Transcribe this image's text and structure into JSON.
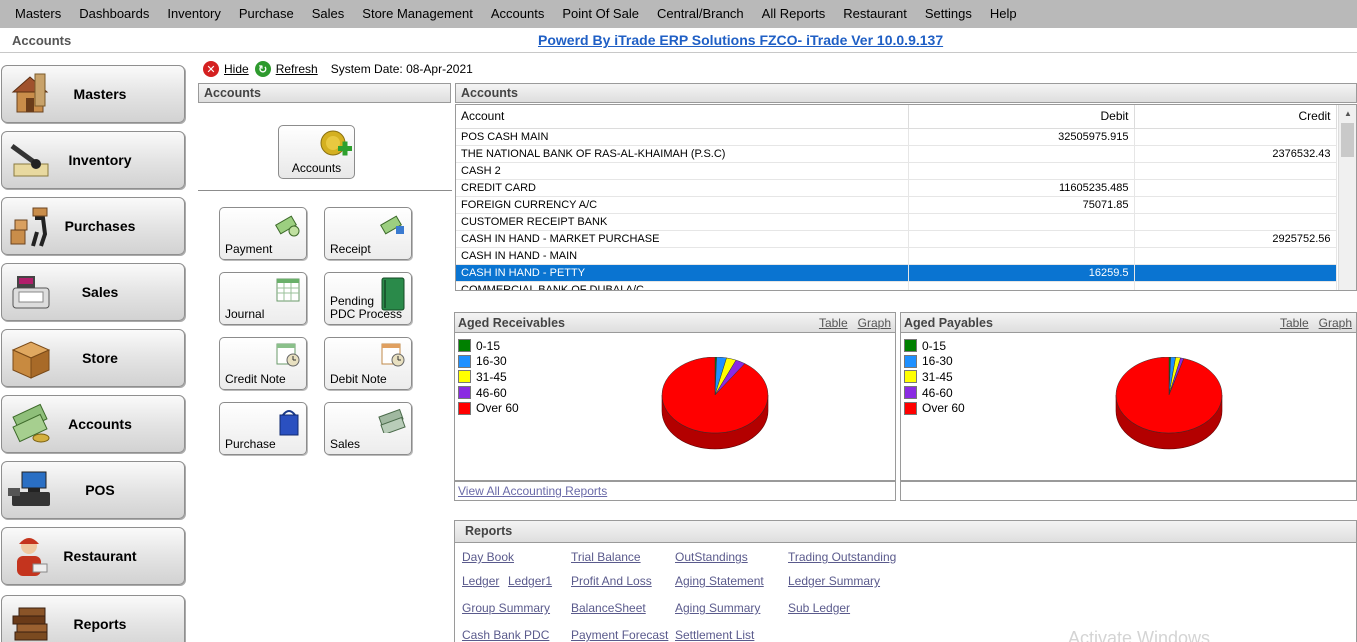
{
  "menu": [
    "Masters",
    "Dashboards",
    "Inventory",
    "Purchase",
    "Sales",
    "Store Management",
    "Accounts",
    "Point Of Sale",
    "Central/Branch",
    "All Reports",
    "Restaurant",
    "Settings",
    "Help"
  ],
  "header": {
    "breadcrumb": "Accounts",
    "brand": "Powerd By iTrade ERP Solutions FZCO- iTrade Ver 10.0.9.137"
  },
  "sidebar": [
    {
      "label": "Masters",
      "icon": "house-icon"
    },
    {
      "label": "Inventory",
      "icon": "stamp-icon"
    },
    {
      "label": "Purchases",
      "icon": "porter-icon"
    },
    {
      "label": "Sales",
      "icon": "cash-register-icon"
    },
    {
      "label": "Store",
      "icon": "boxes-icon"
    },
    {
      "label": "Accounts",
      "icon": "money-icon"
    },
    {
      "label": "POS",
      "icon": "pos-terminal-icon"
    },
    {
      "label": "Restaurant",
      "icon": "chef-icon"
    },
    {
      "label": "Reports",
      "icon": "books-icon"
    }
  ],
  "toolbar": {
    "hide": "Hide",
    "refresh": "Refresh",
    "system_date": "System Date: 08-Apr-2021"
  },
  "left_panel": {
    "title": "Accounts",
    "main_tile": "Accounts",
    "tiles": [
      {
        "label": "Payment",
        "icon": "payment-icon"
      },
      {
        "label": "Receipt",
        "icon": "receipt-icon"
      },
      {
        "label": "Journal",
        "icon": "journal-icon"
      },
      {
        "label": "Pending\nPDC Process",
        "label1": "Pending",
        "label2": "PDC Process",
        "icon": "ledger-book-icon"
      },
      {
        "label": "Credit Note",
        "icon": "credit-note-icon"
      },
      {
        "label": "Debit Note",
        "icon": "debit-note-icon"
      },
      {
        "label": "Purchase",
        "icon": "shopping-bag-icon"
      },
      {
        "label": "Sales",
        "icon": "sales-money-icon"
      }
    ]
  },
  "grid": {
    "title": "Accounts",
    "columns": [
      "Account",
      "Debit",
      "Credit"
    ],
    "rows": [
      {
        "account": "POS CASH MAIN",
        "debit": "32505975.915",
        "credit": ""
      },
      {
        "account": "THE NATIONAL BANK OF RAS-AL-KHAIMAH (P.S.C)",
        "debit": "",
        "credit": "2376532.43"
      },
      {
        "account": "CASH 2",
        "debit": "",
        "credit": ""
      },
      {
        "account": "CREDIT CARD",
        "debit": "11605235.485",
        "credit": ""
      },
      {
        "account": "FOREIGN CURRENCY A/C",
        "debit": "75071.85",
        "credit": ""
      },
      {
        "account": "CUSTOMER RECEIPT BANK",
        "debit": "",
        "credit": ""
      },
      {
        "account": "CASH IN HAND - MARKET PURCHASE",
        "debit": "",
        "credit": "2925752.56"
      },
      {
        "account": "CASH IN HAND - MAIN",
        "debit": "",
        "credit": ""
      },
      {
        "account": "CASH IN HAND - PETTY",
        "debit": "16259.5",
        "credit": "",
        "selected": true
      },
      {
        "account": "COMMERCIAL BANK OF DUBAI A/C",
        "debit": "",
        "credit": ""
      }
    ]
  },
  "aged_receivables": {
    "title": "Aged Receivables",
    "links": [
      "Table",
      "Graph"
    ],
    "legend": [
      "0-15",
      "16-30",
      "31-45",
      "46-60",
      "Over 60"
    ]
  },
  "aged_payables": {
    "title": "Aged Payables",
    "links": [
      "Table",
      "Graph"
    ],
    "legend": [
      "0-15",
      "16-30",
      "31-45",
      "46-60",
      "Over 60"
    ]
  },
  "colors": {
    "b0_15": "#008000",
    "b16_30": "#1e90ff",
    "b31_45": "#ffff00",
    "b46_60": "#8a2be2",
    "over60": "#ff0000"
  },
  "chart_data": [
    {
      "type": "pie",
      "title": "Aged Receivables",
      "labels": [
        "0-15",
        "16-30",
        "31-45",
        "46-60",
        "Over 60"
      ],
      "values": [
        0.5,
        3,
        3,
        3,
        90.5
      ]
    },
    {
      "type": "pie",
      "title": "Aged Payables",
      "labels": [
        "0-15",
        "16-30",
        "31-45",
        "46-60",
        "Over 60"
      ],
      "values": [
        0.5,
        1.5,
        1.5,
        1,
        95.5
      ]
    }
  ],
  "view_all": "View All Accounting Reports",
  "reports": {
    "title": "Reports",
    "links": [
      "Day Book",
      "Trial Balance",
      "OutStandings",
      "Trading Outstanding",
      "Ledger",
      "Ledger1",
      "Profit And Loss",
      "Aging Statement",
      "Ledger Summary",
      "Group Summary",
      "BalanceSheet",
      "Aging Summary",
      "Sub Ledger",
      "Cash Bank PDC",
      "Payment Forecast",
      "Settlement List"
    ]
  },
  "watermark": "Activate Windows"
}
